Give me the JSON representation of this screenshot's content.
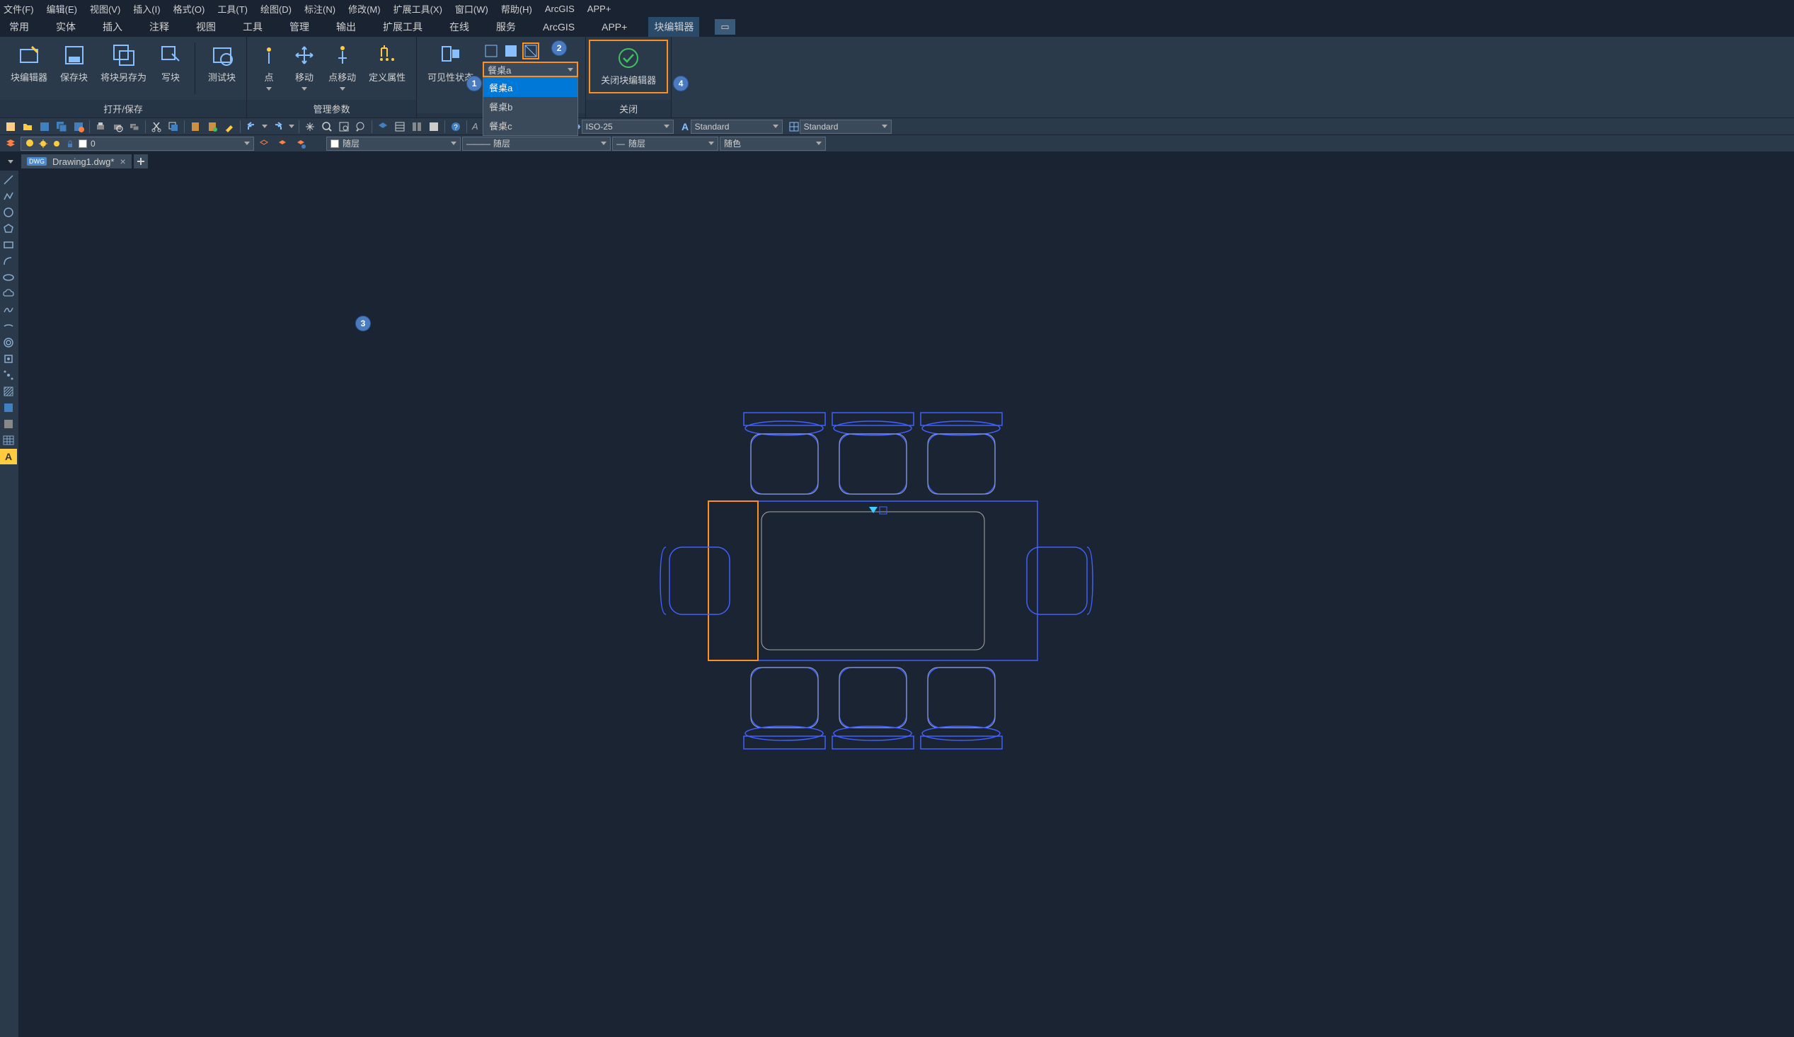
{
  "menuBar": {
    "items": [
      "文件(F)",
      "编辑(E)",
      "视图(V)",
      "插入(I)",
      "格式(O)",
      "工具(T)",
      "绘图(D)",
      "标注(N)",
      "修改(M)",
      "扩展工具(X)",
      "窗口(W)",
      "帮助(H)",
      "ArcGIS",
      "APP+"
    ]
  },
  "ribbonTabs": {
    "items": [
      "常用",
      "实体",
      "插入",
      "注释",
      "视图",
      "工具",
      "管理",
      "输出",
      "扩展工具",
      "在线",
      "服务",
      "ArcGIS",
      "APP+",
      "块编辑器"
    ],
    "activeIndex": 13
  },
  "ribbon": {
    "groups": {
      "openSave": {
        "label": "打开/保存",
        "buttons": [
          "块编辑器",
          "保存块",
          "将块另存为",
          "写块",
          "测试块"
        ]
      },
      "manageParams": {
        "label": "管理参数",
        "buttons": [
          "点",
          "移动",
          "点移动",
          "定义属性"
        ]
      },
      "visibility": {
        "label": "",
        "buttons": [
          "可见性状态"
        ],
        "selectValue": "餐桌a",
        "options": [
          "餐桌a",
          "餐桌b",
          "餐桌c"
        ]
      },
      "close": {
        "label": "关闭",
        "button": "关闭块编辑器"
      }
    }
  },
  "callouts": {
    "c1": "1",
    "c2": "2",
    "c3": "3",
    "c4": "4"
  },
  "qat": {
    "dimStyle": "ISO-25",
    "textStyle": "Standard",
    "tableStyle": "Standard"
  },
  "propsBar": {
    "layer": "0",
    "color": "随层",
    "linetype": "随层",
    "lineweight": "随层",
    "plotStyle": "随色"
  },
  "docTabs": {
    "items": [
      {
        "name": "Drawing1.dwg*",
        "badge": "DWG"
      }
    ]
  }
}
